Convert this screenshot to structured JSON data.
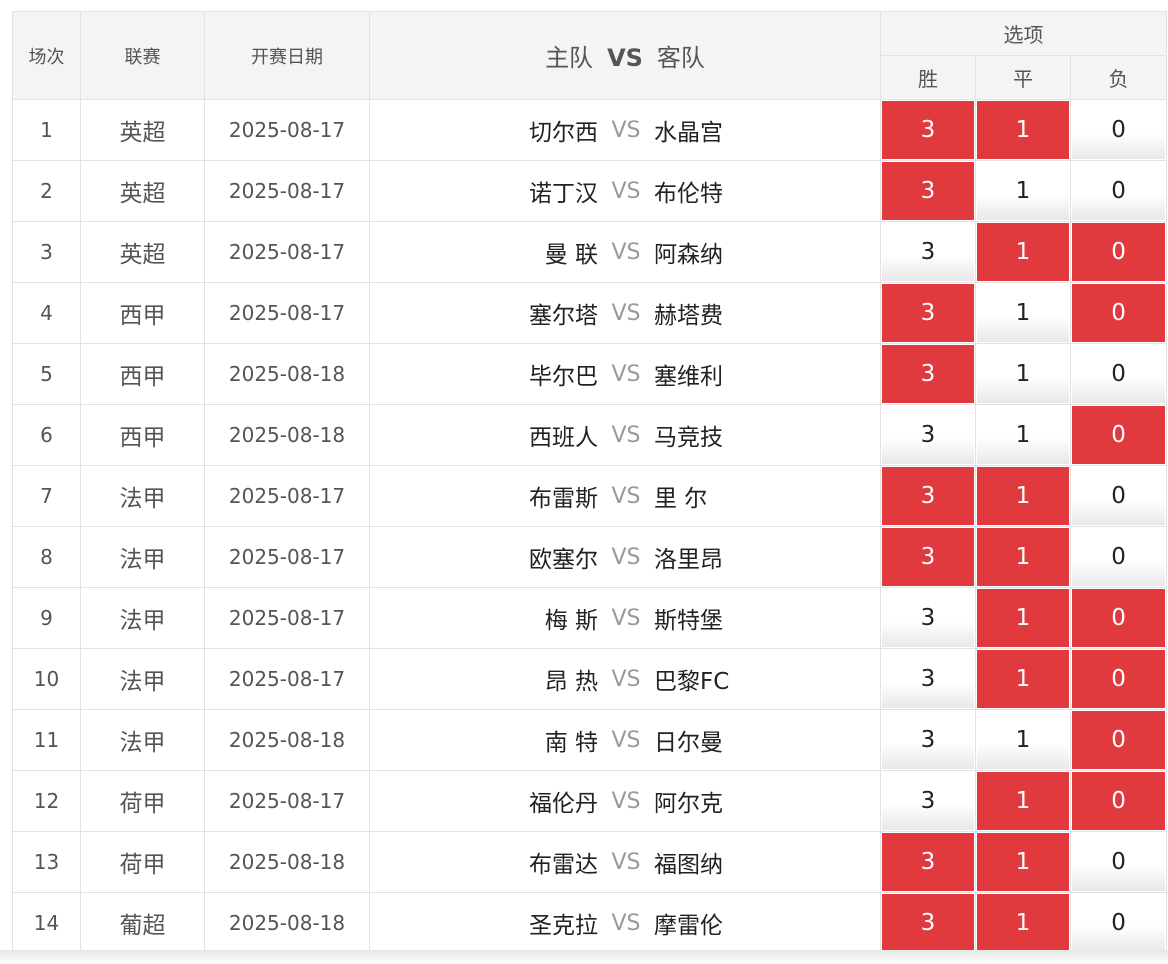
{
  "header": {
    "no": "场次",
    "league": "联赛",
    "date": "开赛日期",
    "home": "主队",
    "vs": "VS",
    "away": "客队",
    "options": "选项",
    "win": "胜",
    "draw": "平",
    "lose": "负"
  },
  "colors": {
    "selected": "#e03a3e",
    "header_bg": "#f4f4f4",
    "border": "#e2e2e2"
  },
  "rows": [
    {
      "no": "1",
      "league": "英超",
      "date": "2025-08-17",
      "home": "切尔西",
      "vs": "VS",
      "away": "水晶宫",
      "win": "3",
      "draw": "1",
      "lose": "0",
      "sel": [
        true,
        true,
        false
      ]
    },
    {
      "no": "2",
      "league": "英超",
      "date": "2025-08-17",
      "home": "诺丁汉",
      "vs": "VS",
      "away": "布伦特",
      "win": "3",
      "draw": "1",
      "lose": "0",
      "sel": [
        true,
        false,
        false
      ]
    },
    {
      "no": "3",
      "league": "英超",
      "date": "2025-08-17",
      "home": "曼 联",
      "vs": "VS",
      "away": "阿森纳",
      "win": "3",
      "draw": "1",
      "lose": "0",
      "sel": [
        false,
        true,
        true
      ]
    },
    {
      "no": "4",
      "league": "西甲",
      "date": "2025-08-17",
      "home": "塞尔塔",
      "vs": "VS",
      "away": "赫塔费",
      "win": "3",
      "draw": "1",
      "lose": "0",
      "sel": [
        true,
        false,
        true
      ]
    },
    {
      "no": "5",
      "league": "西甲",
      "date": "2025-08-18",
      "home": "毕尔巴",
      "vs": "VS",
      "away": "塞维利",
      "win": "3",
      "draw": "1",
      "lose": "0",
      "sel": [
        true,
        false,
        false
      ]
    },
    {
      "no": "6",
      "league": "西甲",
      "date": "2025-08-18",
      "home": "西班人",
      "vs": "VS",
      "away": "马竞技",
      "win": "3",
      "draw": "1",
      "lose": "0",
      "sel": [
        false,
        false,
        true
      ]
    },
    {
      "no": "7",
      "league": "法甲",
      "date": "2025-08-17",
      "home": "布雷斯",
      "vs": "VS",
      "away": "里 尔",
      "win": "3",
      "draw": "1",
      "lose": "0",
      "sel": [
        true,
        true,
        false
      ]
    },
    {
      "no": "8",
      "league": "法甲",
      "date": "2025-08-17",
      "home": "欧塞尔",
      "vs": "VS",
      "away": "洛里昂",
      "win": "3",
      "draw": "1",
      "lose": "0",
      "sel": [
        true,
        true,
        false
      ]
    },
    {
      "no": "9",
      "league": "法甲",
      "date": "2025-08-17",
      "home": "梅 斯",
      "vs": "VS",
      "away": "斯特堡",
      "win": "3",
      "draw": "1",
      "lose": "0",
      "sel": [
        false,
        true,
        true
      ]
    },
    {
      "no": "10",
      "league": "法甲",
      "date": "2025-08-17",
      "home": "昂 热",
      "vs": "VS",
      "away": "巴黎FC",
      "win": "3",
      "draw": "1",
      "lose": "0",
      "sel": [
        false,
        true,
        true
      ]
    },
    {
      "no": "11",
      "league": "法甲",
      "date": "2025-08-18",
      "home": "南 特",
      "vs": "VS",
      "away": "日尔曼",
      "win": "3",
      "draw": "1",
      "lose": "0",
      "sel": [
        false,
        false,
        true
      ]
    },
    {
      "no": "12",
      "league": "荷甲",
      "date": "2025-08-17",
      "home": "福伦丹",
      "vs": "VS",
      "away": "阿尔克",
      "win": "3",
      "draw": "1",
      "lose": "0",
      "sel": [
        false,
        true,
        true
      ]
    },
    {
      "no": "13",
      "league": "荷甲",
      "date": "2025-08-18",
      "home": "布雷达",
      "vs": "VS",
      "away": "福图纳",
      "win": "3",
      "draw": "1",
      "lose": "0",
      "sel": [
        true,
        true,
        false
      ]
    },
    {
      "no": "14",
      "league": "葡超",
      "date": "2025-08-18",
      "home": "圣克拉",
      "vs": "VS",
      "away": "摩雷伦",
      "win": "3",
      "draw": "1",
      "lose": "0",
      "sel": [
        true,
        true,
        false
      ]
    }
  ]
}
